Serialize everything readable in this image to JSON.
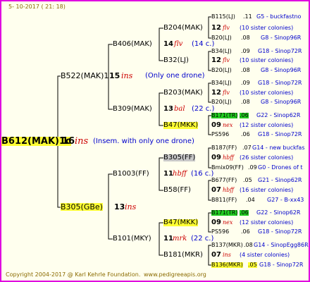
{
  "header": {
    "date": "5- 10-2017 ( 21: 18)"
  },
  "footer": {
    "copyright": "Copyright 2004-2017 @ Karl Kehrle Foundation.",
    "site": "www.pedigreeapis.org"
  },
  "root": {
    "id": "B612(MAK)1c",
    "num": "16",
    "sym": "ins",
    "note": "(Insem. with only one drone)"
  },
  "g1": [
    {
      "id": "B522(MAK)1",
      "num": "15",
      "sym": "ins",
      "note": "(Only one drone)"
    },
    {
      "id": "B305(GBe)",
      "num": "13",
      "sym": "ins"
    }
  ],
  "g2": [
    {
      "id": "B406(MAK)",
      "num": "14",
      "sym": "flv",
      "note": "(14 c.)"
    },
    {
      "id": "B309(MAK)",
      "num": "13",
      "sym": "bal",
      "note": "(22 c.)"
    },
    {
      "id": "B1003(FF)",
      "num": "11",
      "sym": "hbff",
      "note": "(16 c.)"
    },
    {
      "id": "B101(MKY)",
      "num": "11",
      "sym": "mrk",
      "note": "(22 c.)"
    }
  ],
  "g3": [
    {
      "id": "B204(MAK)",
      "num": "12",
      "sym": "flv",
      "note": "(10 sister colonies)"
    },
    {
      "id": "B32(LJ)",
      "num": "12",
      "sym": "flv",
      "note": "(10 sister colonies)"
    },
    {
      "id": "B203(MAK)",
      "num": "12",
      "sym": "flv",
      "note": "(10 sister colonies)"
    },
    {
      "id": "B47(MKK)",
      "num": "09",
      "sym": "nex",
      "note": "(12 sister colonies)"
    },
    {
      "id": "B305(FF)",
      "num": "09",
      "sym": "hbff",
      "note": "(26 sister colonies)"
    },
    {
      "id": "B58(FF)",
      "num": "07",
      "sym": "hbff",
      "note": "(16 sister colonies)"
    },
    {
      "id": "B47(MKK)",
      "num": "09",
      "sym": "nex",
      "note": "(12 sister colonies)"
    },
    {
      "id": "B181(MKR)",
      "num": "07",
      "sym": "ins",
      "note": "(4 sister colonies)"
    }
  ],
  "g4": [
    {
      "id": "B115(LJ)",
      "val": ".11",
      "desc": "G5 - buckfastno"
    },
    {
      "id": "B20(LJ)",
      "val": ".08",
      "desc": "G8 - Sinop96R"
    },
    {
      "id": "B34(LJ)",
      "val": ".09",
      "desc": "G18 - Sinop72R"
    },
    {
      "id": "B20(LJ)",
      "val": ".08",
      "desc": "G8 - Sinop96R"
    },
    {
      "id": "B34(LJ)",
      "val": ".09",
      "desc": "G18 - Sinop72R"
    },
    {
      "id": "B20(LJ)",
      "val": ".08",
      "desc": "G8 - Sinop96R"
    },
    {
      "id": "B171(TR)",
      "val": ".06",
      "desc": "G22 - Sinop62R"
    },
    {
      "id": "PS596",
      "val": ".06",
      "desc": "G18 - Sinop72R"
    },
    {
      "id": "B187(FF)",
      "val": ".07",
      "desc": "G14 - new buckfas"
    },
    {
      "id": "Bmix09(FF)",
      "val": ".09",
      "desc": "G0 - Drones of t"
    },
    {
      "id": "B677(FF)",
      "val": ".05",
      "desc": "G21 - Sinop62R"
    },
    {
      "id": "B811(FF)",
      "val": ".04",
      "desc": "G27 - B-xx43"
    },
    {
      "id": "B171(TR)",
      "val": ".06",
      "desc": "G22 - Sinop62R"
    },
    {
      "id": "PS596",
      "val": ".06",
      "desc": "G18 - Sinop72R"
    },
    {
      "id": "B137(MKR)",
      "val": ".08",
      "desc": "G14 - SinopEgg86R"
    },
    {
      "id": "B136(MKR)",
      "val": ".05",
      "desc": "G18 - Sinop72R"
    }
  ]
}
